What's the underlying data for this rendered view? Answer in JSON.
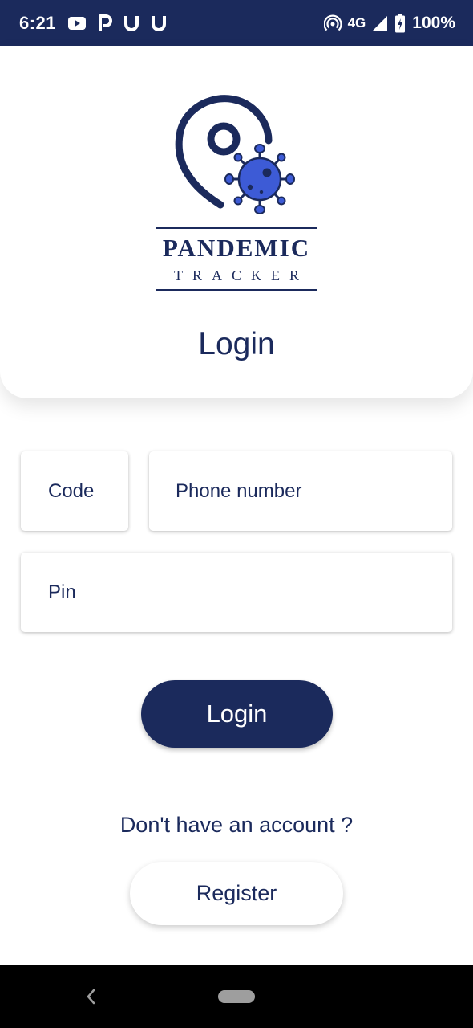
{
  "status_bar": {
    "time": "6:21",
    "notification_icons": [
      "youtube-icon",
      "paytm-icon",
      "u-icon",
      "u-icon"
    ],
    "network_label": "4G",
    "battery_percent": "100%"
  },
  "header": {
    "brand_title": "PANDEMIC",
    "brand_subtitle": "TRACKER",
    "title": "Login"
  },
  "form": {
    "code_placeholder": "Code",
    "phone_placeholder": "Phone number",
    "pin_placeholder": "Pin"
  },
  "actions": {
    "login_label": "Login",
    "no_account_text": "Don't have an account ?",
    "register_label": "Register"
  },
  "colors": {
    "primary": "#1b2a5c",
    "accent_virus": "#3d5bd6",
    "background": "#ffffff",
    "nav_bar": "#000000"
  }
}
